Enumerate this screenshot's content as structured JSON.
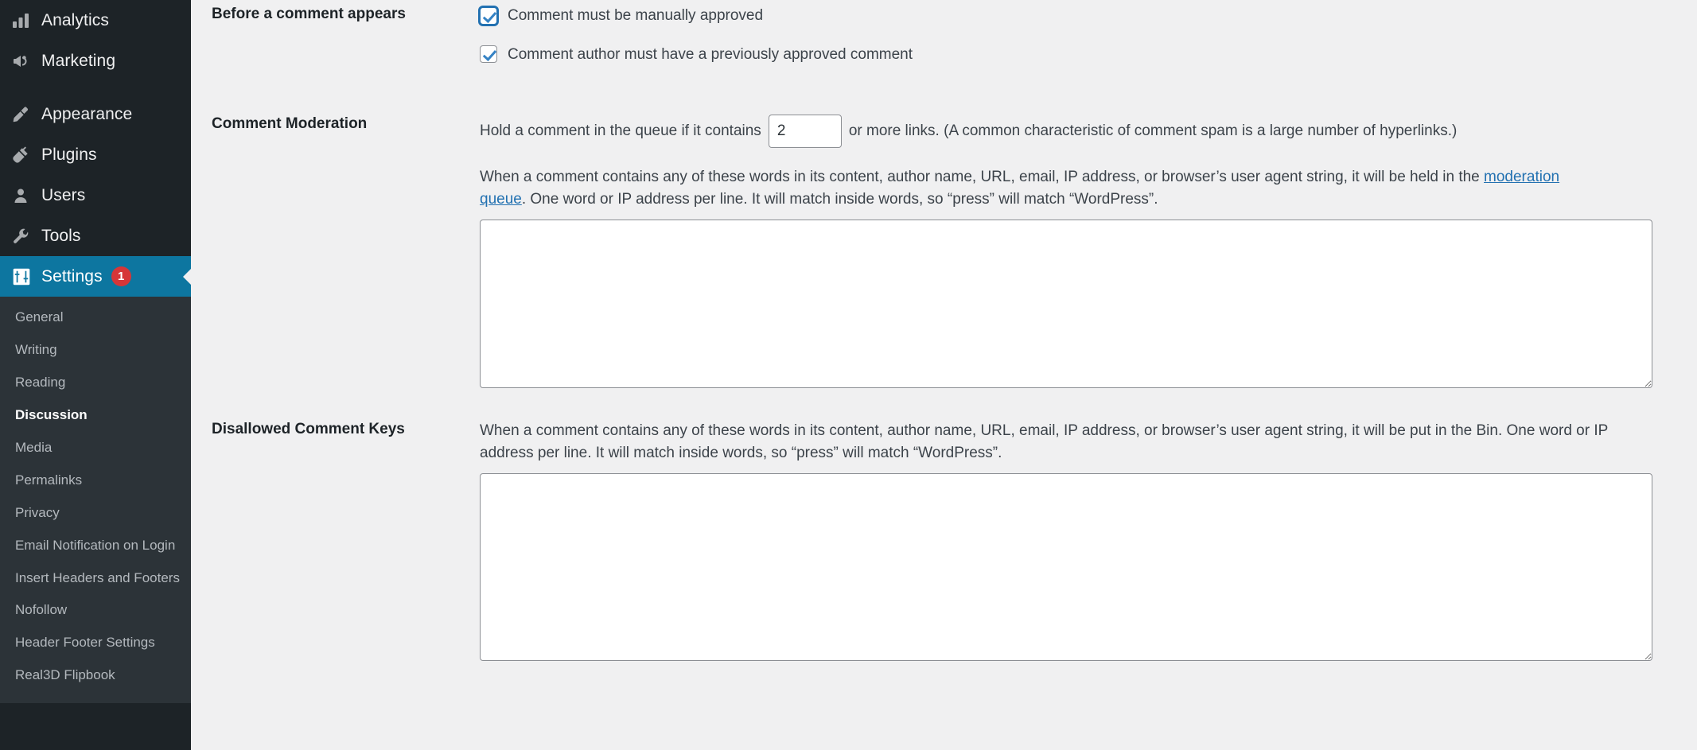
{
  "sidebar": {
    "top_items": [
      {
        "label": "Analytics",
        "icon": "analytics-bars-icon",
        "current": false,
        "badge": null,
        "gap_after": false
      },
      {
        "label": "Marketing",
        "icon": "megaphone-icon",
        "current": false,
        "badge": null,
        "gap_after": true
      },
      {
        "label": "Appearance",
        "icon": "paintbrush-icon",
        "current": false,
        "badge": null,
        "gap_after": false
      },
      {
        "label": "Plugins",
        "icon": "plug-icon",
        "current": false,
        "badge": null,
        "gap_after": false
      },
      {
        "label": "Users",
        "icon": "user-icon",
        "current": false,
        "badge": null,
        "gap_after": false
      },
      {
        "label": "Tools",
        "icon": "wrench-icon",
        "current": false,
        "badge": null,
        "gap_after": false
      },
      {
        "label": "Settings",
        "icon": "settings-sliders-icon",
        "current": true,
        "badge": "1",
        "gap_after": false
      }
    ],
    "submenu": [
      {
        "label": "General",
        "current": false
      },
      {
        "label": "Writing",
        "current": false
      },
      {
        "label": "Reading",
        "current": false
      },
      {
        "label": "Discussion",
        "current": true
      },
      {
        "label": "Media",
        "current": false
      },
      {
        "label": "Permalinks",
        "current": false
      },
      {
        "label": "Privacy",
        "current": false
      },
      {
        "label": "Email Notification on Login",
        "current": false
      },
      {
        "label": "Insert Headers and Footers",
        "current": false
      },
      {
        "label": "Nofollow",
        "current": false
      },
      {
        "label": "Header Footer Settings",
        "current": false
      },
      {
        "label": "Real3D Flipbook",
        "current": false
      }
    ],
    "colors": {
      "background": "#1d2327",
      "submenu_background": "#2c3338",
      "current_highlight": "#0d76a0",
      "badge": "#d63638",
      "label": "#f0f0f1"
    }
  },
  "main": {
    "before_comment_appears": {
      "label": "Before a comment appears",
      "options": [
        {
          "label": "Comment must be manually approved",
          "checked": true,
          "focused": true
        },
        {
          "label": "Comment author must have a previously approved comment",
          "checked": true,
          "focused": false
        }
      ]
    },
    "comment_moderation": {
      "label": "Comment Moderation",
      "hold_prefix": "Hold a comment in the queue if it contains",
      "links_value": "2",
      "hold_suffix": "or more links. (A common characteristic of comment spam is a large number of hyperlinks.)",
      "description_part1": "When a comment contains any of these words in its content, author name, URL, email, IP address, or browser’s user agent string, it will be held in the",
      "description_link": "moderation queue",
      "description_part2": ". One word or IP address per line. It will match inside words, so “press” will match “WordPress”.",
      "textarea_value": "",
      "textarea_placeholder": ""
    },
    "disallowed_comment_keys": {
      "label": "Disallowed Comment Keys",
      "description": "When a comment contains any of these words in its content, author name, URL, email, IP address, or browser’s user agent string, it will be put in the Bin. One word or IP address per line. It will match inside words, so “press” will match “WordPress”.",
      "textarea_value": "",
      "textarea_placeholder": ""
    },
    "colors": {
      "background": "#f0f0f1",
      "text": "#3c434a",
      "heading": "#1d2327",
      "link": "#2271b1",
      "input_border": "#8c8f94"
    }
  }
}
